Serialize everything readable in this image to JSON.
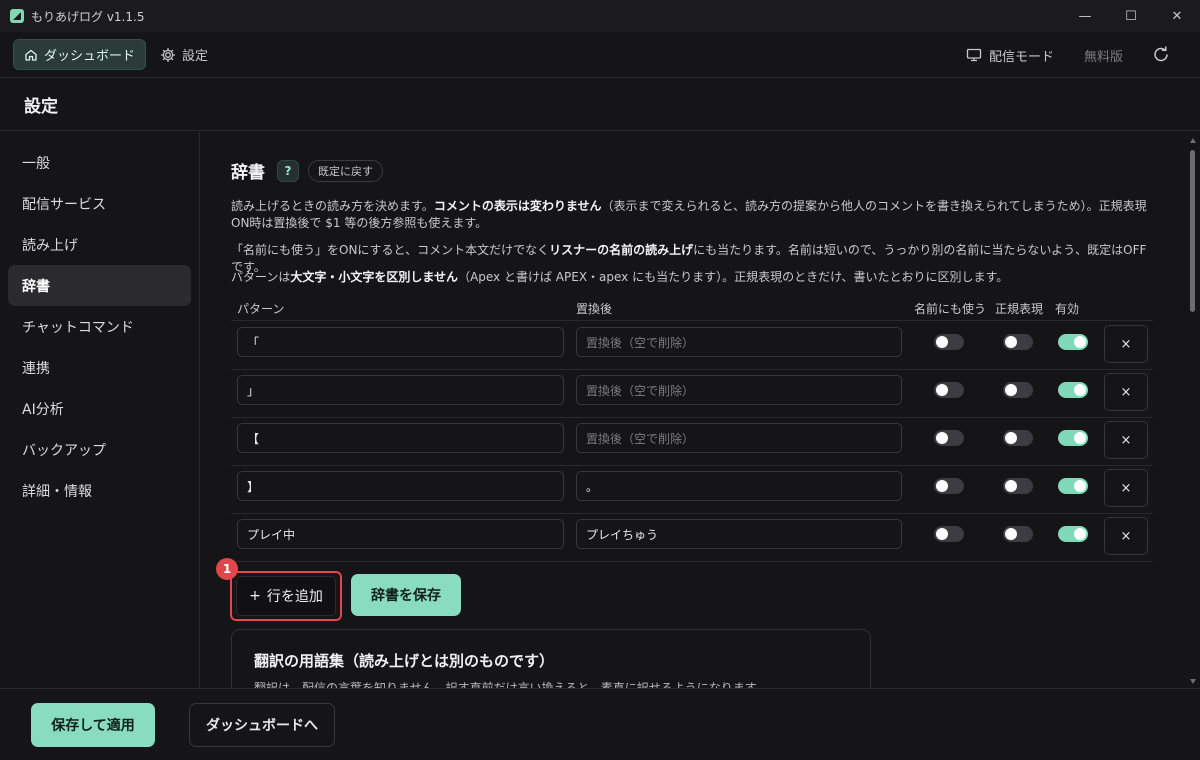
{
  "app": {
    "title": "もりあげログ  v1.1.5",
    "accent": "#7fd8b6",
    "badge_color": "#e0474a"
  },
  "window_controls": {
    "minimize": "—",
    "maximize": "☐",
    "close": "✕"
  },
  "topnav": {
    "dashboard": "ダッシュボード",
    "settings": "設定",
    "stream_mode": "配信モード",
    "edition": "無料版"
  },
  "page": {
    "title": "設定"
  },
  "sidebar": {
    "items": [
      {
        "label": "一般"
      },
      {
        "label": "配信サービス"
      },
      {
        "label": "読み上げ"
      },
      {
        "label": "辞書",
        "active": true
      },
      {
        "label": "チャットコマンド"
      },
      {
        "label": "連携"
      },
      {
        "label": "AI分析"
      },
      {
        "label": "バックアップ"
      },
      {
        "label": "詳細・情報"
      }
    ]
  },
  "dictionary": {
    "title": "辞書",
    "help": "?",
    "reset": "既定に戻す",
    "desc1": {
      "a": "読み上げるときの読み方を決めます。",
      "b": "コメントの表示は変わりません",
      "c": "（表示まで変えられると、読み方の提案から他人のコメントを書き換えられてしまうため）。正規表現ON時は置換後で $1 等の後方参照も使えます。"
    },
    "desc2": {
      "a": "「名前にも使う」をONにすると、コメント本文だけでなく",
      "b": "リスナーの名前の読み上げ",
      "c": "にも当たります。名前は短いので、うっかり別の名前に当たらないよう、既定はOFFです。"
    },
    "desc3": {
      "a": "パターンは",
      "b": "大文字・小文字を区別しません",
      "c": "（Apex と書けば APEX・apex にも当たります）。正規表現のときだけ、書いたとおりに区別します。"
    },
    "columns": {
      "pattern": "パターン",
      "replacement": "置換後",
      "use_for_names": "名前にも使う",
      "regex": "正規表現",
      "enabled": "有効"
    },
    "replacement_placeholder": "置換後（空で削除）",
    "delete_label": "×",
    "rows": [
      {
        "pattern": "「",
        "replacement": "",
        "names": false,
        "regex": false,
        "enabled": true
      },
      {
        "pattern": "」",
        "replacement": "",
        "names": false,
        "regex": false,
        "enabled": true
      },
      {
        "pattern": "【",
        "replacement": "",
        "names": false,
        "regex": false,
        "enabled": true
      },
      {
        "pattern": "】",
        "replacement": "。",
        "names": false,
        "regex": false,
        "enabled": true
      },
      {
        "pattern": "プレイ中",
        "replacement": "プレイちゅう",
        "names": false,
        "regex": false,
        "enabled": true
      }
    ],
    "add_row": "行を追加",
    "add_icon": "+",
    "badge": "1",
    "save": "辞書を保存"
  },
  "glossary": {
    "title": "翻訳の用語集（読み上げとは別のものです）",
    "desc": "翻訳は、配信の言葉を知りません。訳す直前だけ言い換えると、素直に訳せるようになります。"
  },
  "footer": {
    "save_apply": "保存して適用",
    "to_dashboard": "ダッシュボードへ"
  }
}
